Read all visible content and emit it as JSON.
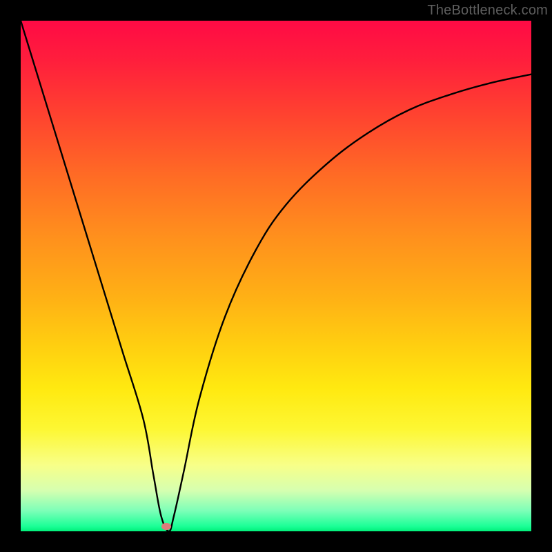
{
  "watermark": "TheBottleneck.com",
  "chart_data": {
    "type": "line",
    "title": "",
    "xlabel": "",
    "ylabel": "",
    "xlim": [
      0,
      100
    ],
    "ylim": [
      0,
      100
    ],
    "series": [
      {
        "name": "curve",
        "x": [
          0,
          4,
          8,
          12,
          16,
          20,
          24,
          26,
          27.5,
          29,
          30,
          32,
          35,
          40,
          46,
          52,
          60,
          68,
          76,
          84,
          92,
          100
        ],
        "values": [
          100,
          87,
          74,
          61,
          48,
          35,
          22,
          11,
          3,
          0,
          3,
          12,
          26,
          42,
          55,
          64,
          72,
          78,
          82.5,
          85.5,
          87.8,
          89.5
        ]
      }
    ],
    "annotations": [
      {
        "name": "dot",
        "x": 28.5,
        "y": 1.0
      }
    ],
    "background_gradient": {
      "top": "#ff0a45",
      "bottom": "#00f07a"
    }
  }
}
